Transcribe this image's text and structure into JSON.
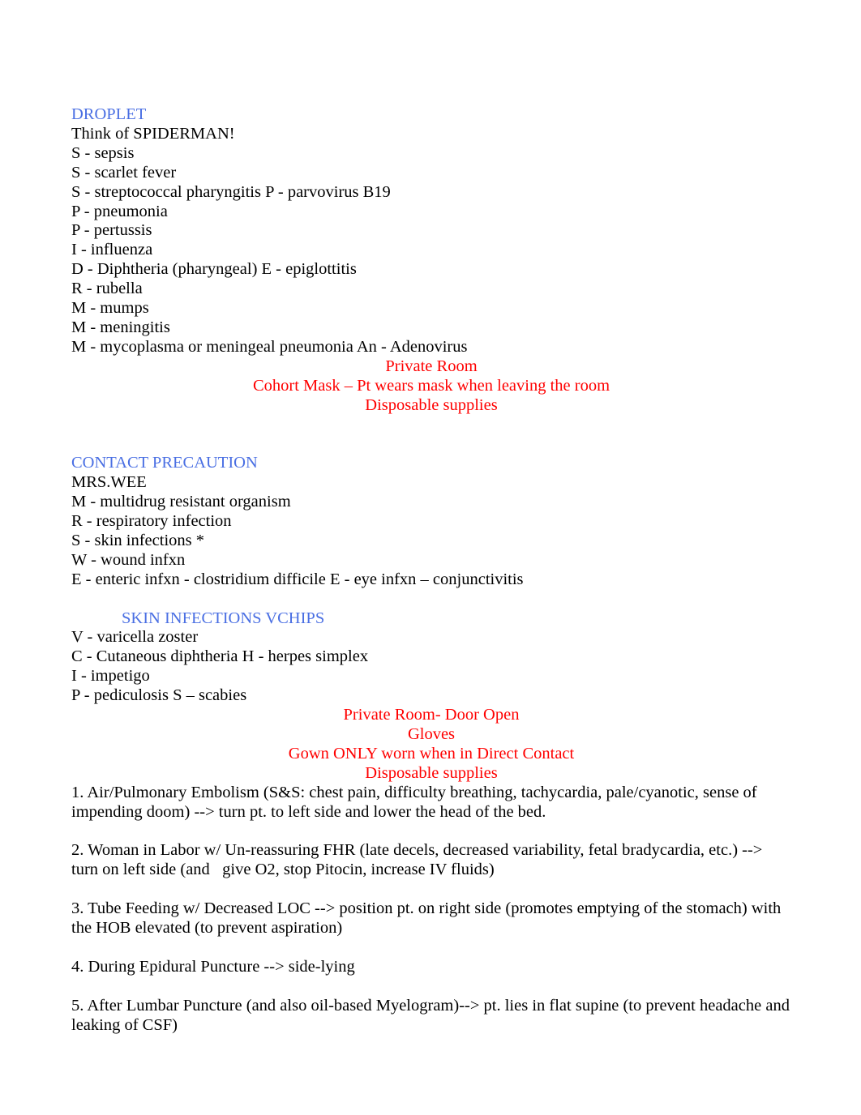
{
  "document": {
    "colors": {
      "heading": "#4a6fe3",
      "emphasis": "#ff0000",
      "body": "#000000",
      "background": "#ffffff"
    },
    "sections": {
      "droplet": {
        "heading": "DROPLET",
        "mnemonic_intro": "Think of SPIDERMAN!",
        "items": [
          "S - sepsis",
          "S - scarlet fever",
          "S - streptococcal pharyngitis P - parvovirus B19",
          "P - pneumonia",
          "P - pertussis",
          "I - influenza",
          "D - Diphtheria (pharyngeal) E - epiglottitis",
          "R - rubella",
          "M - mumps",
          "M - meningitis",
          "M - mycoplasma or meningeal pneumonia An - Adenovirus"
        ],
        "requirements": [
          "Private Room",
          "Cohort Mask – Pt wears mask when leaving the room",
          "Disposable supplies"
        ]
      },
      "contact": {
        "heading": "CONTACT PRECAUTION",
        "mnemonic_intro": "MRS.WEE",
        "items": [
          "M - multidrug resistant organism",
          "R - respiratory infection",
          "S - skin infections *",
          "W - wound infxn",
          "E - enteric infxn - clostridium difficile E - eye infxn – conjunctivitis"
        ]
      },
      "skin_infections": {
        "heading": "SKIN INFECTIONS VCHIPS",
        "items": [
          "V - varicella zoster",
          "C - Cutaneous diphtheria H - herpes simplex",
          "I - impetigo",
          "P - pediculosis S – scabies"
        ],
        "requirements": [
          "Private Room- Door Open",
          "Gloves",
          "Gown ONLY worn when in Direct Contact",
          "Disposable supplies"
        ]
      },
      "positioning": {
        "items": [
          "1. Air/Pulmonary Embolism (S&S: chest pain, difficulty breathing, tachycardia, pale/cyanotic, sense of impending doom) --> turn pt. to left side and lower the head of the bed.",
          "2. Woman in Labor w/ Un-reassuring FHR (late decels, decreased variability, fetal bradycardia, etc.) --> turn on left side (and   give O2, stop Pitocin, increase IV fluids)",
          "3. Tube Feeding w/ Decreased LOC --> position pt. on right side (promotes emptying of the stomach) with the HOB elevated (to prevent aspiration)",
          "4. During Epidural Puncture --> side-lying",
          "5. After Lumbar Puncture (and also oil-based Myelogram)--> pt. lies in flat supine (to prevent headache and leaking of CSF)"
        ]
      }
    }
  }
}
